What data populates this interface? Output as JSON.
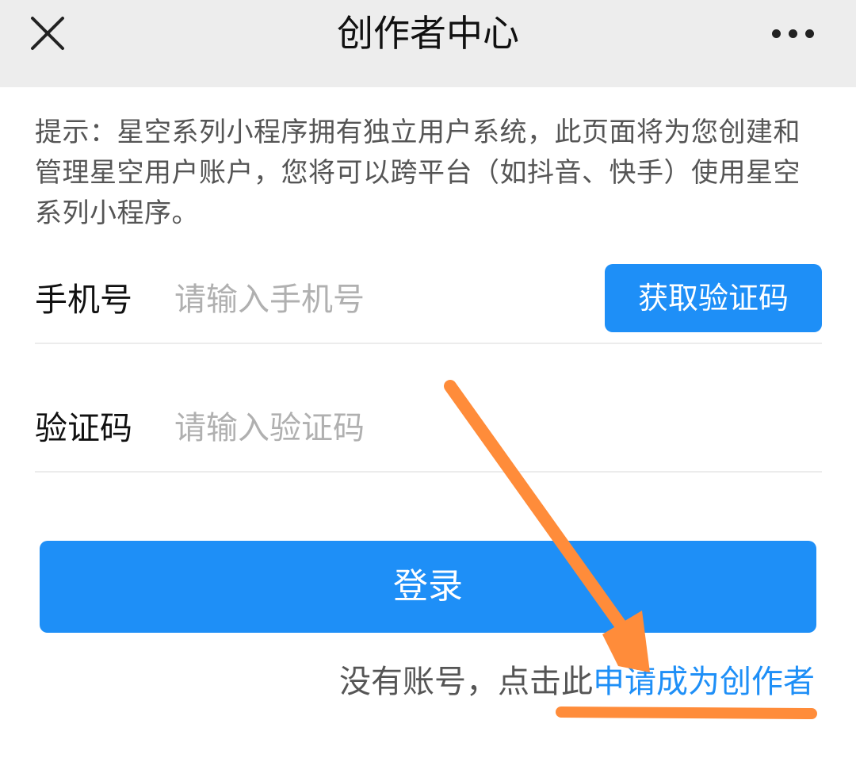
{
  "navbar": {
    "title": "创作者中心",
    "close_icon": "close-icon",
    "more_icon": "more-dots-icon"
  },
  "hint": {
    "text": "提示：星空系列小程序拥有独立用户系统，此页面将为您创建和管理星空用户账户，您将可以跨平台（如抖音、快手）使用星空系列小程序。"
  },
  "form": {
    "phone_label": "手机号",
    "phone_placeholder": "请输入手机号",
    "sms_button": "获取验证码",
    "code_label": "验证码",
    "code_placeholder": "请输入验证码"
  },
  "login_button": "登录",
  "signup": {
    "prefix": "没有账号，点击此",
    "link": "申请成为创作者"
  },
  "colors": {
    "accent": "#1e8ff7",
    "annotation": "#ff8c3a",
    "navbar_bg": "#ededed"
  }
}
